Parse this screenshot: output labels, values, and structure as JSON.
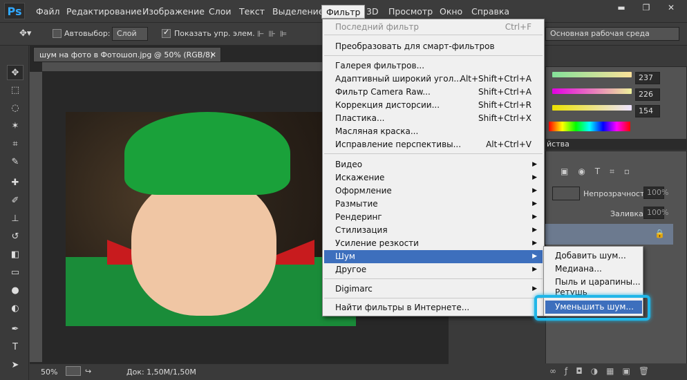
{
  "app": {
    "logo": "Ps"
  },
  "menubar": {
    "items": [
      "Файл",
      "Редактирование",
      "Изображение",
      "Слои",
      "Текст",
      "Выделение",
      "Фильтр",
      "3D",
      "Просмотр",
      "Окно",
      "Справка"
    ],
    "active": "Фильтр"
  },
  "options": {
    "autoselect_label": "Автовыбор:",
    "autoselect_value": "Слой",
    "show_controls": "Показать упр. элем.",
    "workspace": "Основная рабочая среда"
  },
  "document": {
    "tab_title": "шум на фото в Фотошоп.jpg @ 50% (RGB/8)",
    "zoom": "50%",
    "doc_info": "Док: 1,50М/1,50М"
  },
  "color_panel": {
    "r": "237",
    "g": "226",
    "b": "154"
  },
  "layers_panel": {
    "tab_label": "йства",
    "opacity_label": "Непрозрачность:",
    "opacity_value": "100%",
    "fill_label": "Заливка:",
    "fill_value": "100%"
  },
  "filter_menu": {
    "items": [
      {
        "label": "Последний фильтр",
        "shortcut": "Ctrl+F",
        "disabled": true
      },
      {
        "label": "Преобразовать для смарт-фильтров"
      },
      {
        "label": "Галерея фильтров..."
      },
      {
        "label": "Адаптивный широкий угол...",
        "shortcut": "Alt+Shift+Ctrl+A"
      },
      {
        "label": "Фильтр Camera Raw...",
        "shortcut": "Shift+Ctrl+A"
      },
      {
        "label": "Коррекция дисторсии...",
        "shortcut": "Shift+Ctrl+R"
      },
      {
        "label": "Пластика...",
        "shortcut": "Shift+Ctrl+X"
      },
      {
        "label": "Масляная краска..."
      },
      {
        "label": "Исправление перспективы...",
        "shortcut": "Alt+Ctrl+V"
      },
      {
        "label": "Видео",
        "submenu": true
      },
      {
        "label": "Искажение",
        "submenu": true
      },
      {
        "label": "Оформление",
        "submenu": true
      },
      {
        "label": "Размытие",
        "submenu": true
      },
      {
        "label": "Рендеринг",
        "submenu": true
      },
      {
        "label": "Стилизация",
        "submenu": true
      },
      {
        "label": "Усиление резкости",
        "submenu": true
      },
      {
        "label": "Шум",
        "submenu": true,
        "highlighted": true
      },
      {
        "label": "Другое",
        "submenu": true
      },
      {
        "label": "Digimarc",
        "submenu": true
      },
      {
        "label": "Найти фильтры в Интернете..."
      }
    ]
  },
  "noise_submenu": {
    "items": [
      "Добавить шум...",
      "Медиана...",
      "Пыль и царапины...",
      "Ретушь",
      "Уменьшить шум..."
    ],
    "highlighted": "Уменьшить шум..."
  },
  "colors": {
    "accent": "#1fb6e8",
    "menu_highlight": "#3d6fbd"
  }
}
